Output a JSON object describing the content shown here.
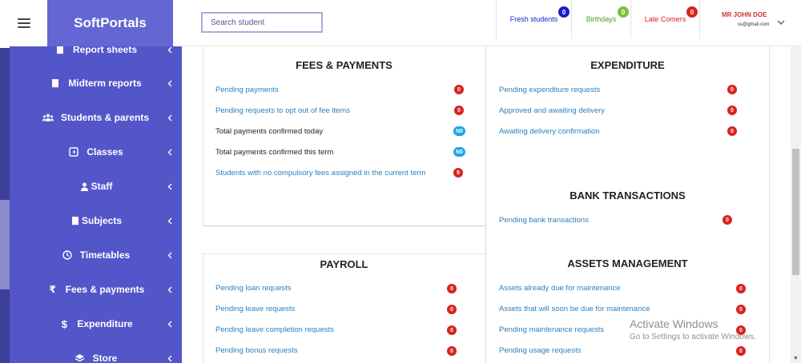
{
  "brand": "SoftPortals",
  "header": {
    "search_placeholder": "Search student",
    "fresh_students": {
      "label": "Fresh students",
      "count": "0",
      "color": "#1a20c7"
    },
    "birthdays": {
      "label": "Birthdays",
      "count": "0",
      "color": "#4c9b1d"
    },
    "late_comers": {
      "label": "Late Comers",
      "count": "0",
      "color": "#d9231f"
    },
    "user": {
      "name": "MR JOHN DOE",
      "email": "ss@gmail.com"
    }
  },
  "sidebar": {
    "items": [
      {
        "label": "Report sheets",
        "icon": "book-icon"
      },
      {
        "label": "Midterm reports",
        "icon": "book-icon"
      },
      {
        "label": "Students & parents",
        "icon": "users-icon"
      },
      {
        "label": "Classes",
        "icon": "class-icon"
      },
      {
        "label": "Staff",
        "icon": "user-icon"
      },
      {
        "label": "Subjects",
        "icon": "book-icon"
      },
      {
        "label": "Timetables",
        "icon": "clock-icon"
      },
      {
        "label": "Fees & payments",
        "icon": "rupee-icon"
      },
      {
        "label": "Expenditure",
        "icon": "dollar-icon"
      },
      {
        "label": "Store",
        "icon": "store-icon"
      }
    ]
  },
  "fees": {
    "title": "FEES & PAYMENTS",
    "rows": [
      {
        "label": "Pending payments",
        "count": "0"
      },
      {
        "label": "Pending requests to opt out of fee items",
        "count": "0"
      },
      {
        "label": "Total payments confirmed today",
        "count": "N0"
      },
      {
        "label": "Total payments confirmed this term",
        "count": "N0"
      },
      {
        "label": "Students with no compulsory fees assigned in the current term",
        "count": "9"
      }
    ]
  },
  "expenditure": {
    "title": "EXPENDITURE",
    "rows": [
      {
        "label": "Pending expenditure requests",
        "count": "0"
      },
      {
        "label": "Approved and awaiting delivery",
        "count": "0"
      },
      {
        "label": "Awaiting delivery confirmation",
        "count": "0"
      }
    ]
  },
  "bank": {
    "title": "BANK TRANSACTIONS",
    "rows": [
      {
        "label": "Pending bank transactions",
        "count": "0"
      }
    ]
  },
  "payroll": {
    "title": "PAYROLL",
    "rows": [
      {
        "label": "Pending loan requests",
        "count": "0"
      },
      {
        "label": "Pending leave requests",
        "count": "0"
      },
      {
        "label": "Pending leave completion requests",
        "count": "0"
      },
      {
        "label": "Pending bonus requests",
        "count": "0"
      }
    ]
  },
  "assets": {
    "title": "ASSETS MANAGEMENT",
    "rows": [
      {
        "label": "Assets already due for maintenance",
        "count": "0"
      },
      {
        "label": "Assets that will soon be due for maintenance",
        "count": "0"
      },
      {
        "label": "Pending maintenance requests",
        "count": "0"
      },
      {
        "label": "Pending usage requests",
        "count": "0"
      }
    ]
  },
  "watermark": {
    "line1": "Activate Windows",
    "line2": "Go to Settings to activate Windows."
  }
}
